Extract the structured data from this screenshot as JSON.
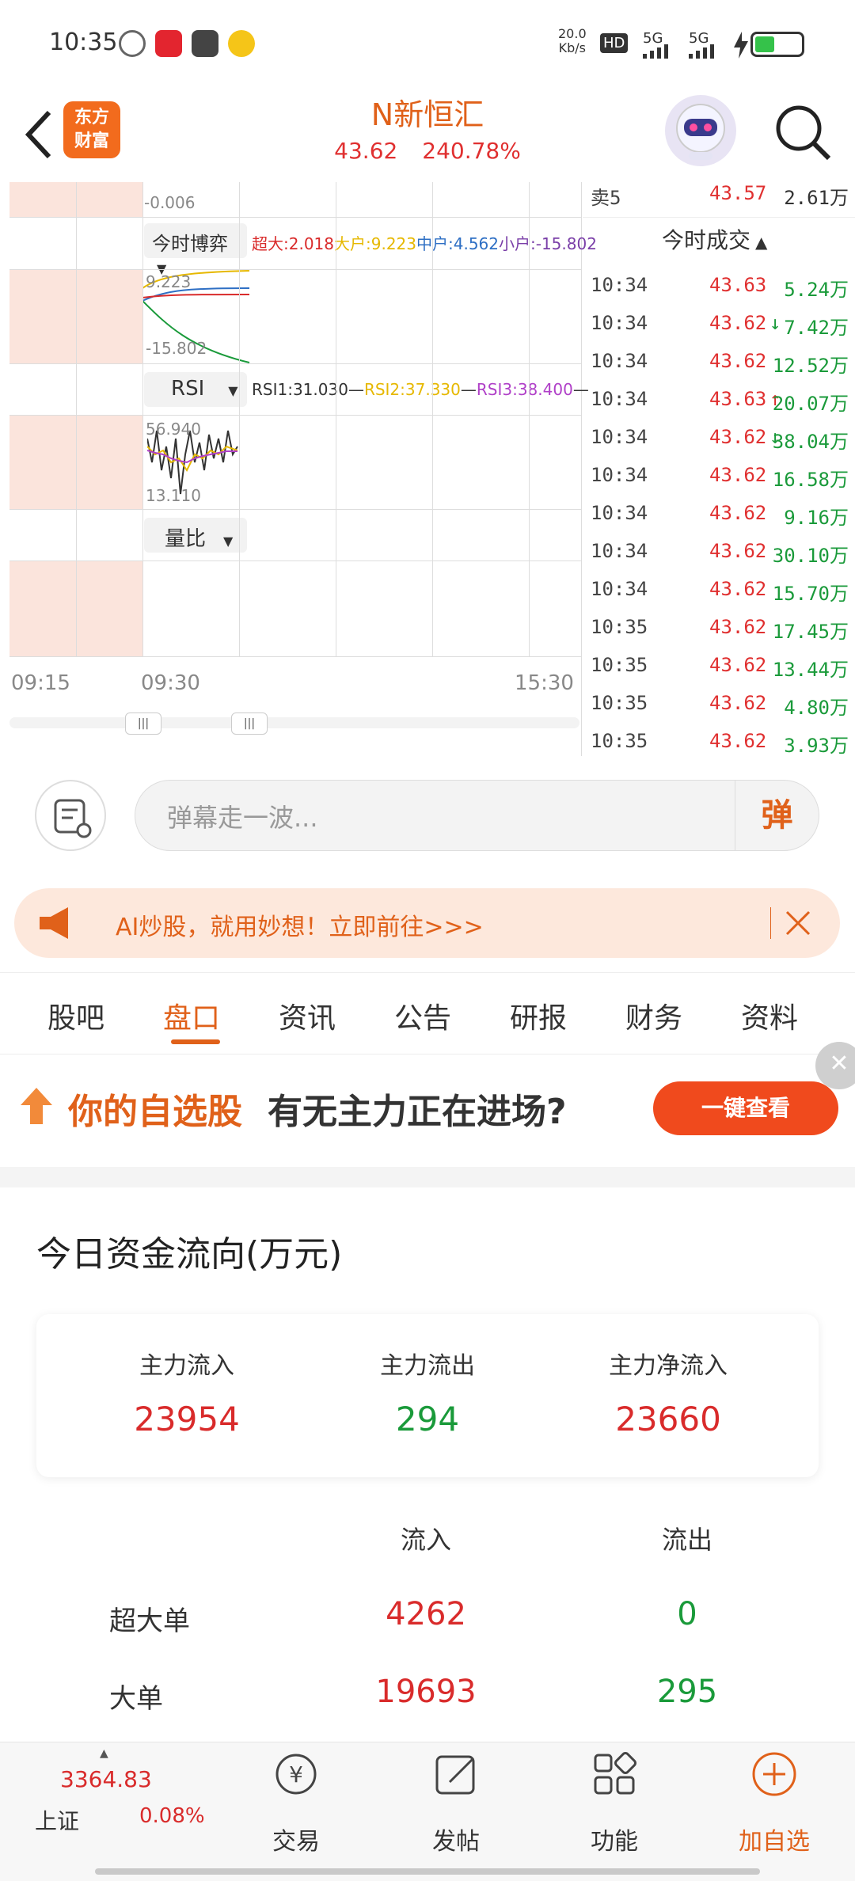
{
  "status_bar": {
    "time": "10:35",
    "net_speed": "20.0",
    "net_unit": "Kb/s",
    "hd": "HD",
    "signal1": "5G",
    "signal2": "5G"
  },
  "header": {
    "logo_line1": "东方",
    "logo_line2": "财富",
    "stock_name": "N新恒汇",
    "price": "43.62",
    "change_pct": "240.78%"
  },
  "chart": {
    "top_value": "-0.006",
    "indicator1": {
      "label": "今时博弈",
      "super_large": "超大:2.018",
      "large": "大户:9.223",
      "medium": "中户:4.562",
      "small": "小户:-15.802",
      "axis_top": "9.223",
      "axis_bottom": "-15.802"
    },
    "indicator2": {
      "label": "RSI",
      "rsi1": "RSI1:31.030",
      "rsi2": "RSI2:37.330",
      "rsi3": "RSI3:38.400",
      "axis_top": "56.940",
      "axis_bottom": "13.110"
    },
    "indicator3": {
      "label": "量比"
    },
    "time_axis": [
      "09:15",
      "09:30",
      "15:30"
    ]
  },
  "trades": {
    "sell5_label": "卖5",
    "sell5_price": "43.57",
    "sell5_vol": "2.61万",
    "header": "今时成交",
    "rows": [
      {
        "time": "10:34",
        "price": "43.63",
        "vol": "5.24万",
        "dir": ""
      },
      {
        "time": "10:34",
        "price": "43.62",
        "vol": "7.42万",
        "dir": "down"
      },
      {
        "time": "10:34",
        "price": "43.62",
        "vol": "12.52万",
        "dir": ""
      },
      {
        "time": "10:34",
        "price": "43.63",
        "vol": "20.07万",
        "dir": "up"
      },
      {
        "time": "10:34",
        "price": "43.62",
        "vol": "38.04万",
        "dir": "down"
      },
      {
        "time": "10:34",
        "price": "43.62",
        "vol": "16.58万",
        "dir": ""
      },
      {
        "time": "10:34",
        "price": "43.62",
        "vol": "9.16万",
        "dir": ""
      },
      {
        "time": "10:34",
        "price": "43.62",
        "vol": "30.10万",
        "dir": ""
      },
      {
        "time": "10:34",
        "price": "43.62",
        "vol": "15.70万",
        "dir": ""
      },
      {
        "time": "10:35",
        "price": "43.62",
        "vol": "17.45万",
        "dir": ""
      },
      {
        "time": "10:35",
        "price": "43.62",
        "vol": "13.44万",
        "dir": ""
      },
      {
        "time": "10:35",
        "price": "43.62",
        "vol": "4.80万",
        "dir": ""
      },
      {
        "time": "10:35",
        "price": "43.62",
        "vol": "3.93万",
        "dir": ""
      }
    ]
  },
  "comment": {
    "placeholder": "弹幕走一波...",
    "danmu_label": "弹"
  },
  "ai_banner": {
    "text": "AI炒股，就用妙想！立即前往>>>"
  },
  "tabs": [
    "股吧",
    "盘口",
    "资讯",
    "公告",
    "研报",
    "财务",
    "资料"
  ],
  "active_tab": "盘口",
  "ad": {
    "text_highlight": "你的自选股",
    "text_rest": "有无主力正在进场?",
    "button": "一键查看"
  },
  "capital_flow": {
    "title": "今日资金流向(万元)",
    "main_in_label": "主力流入",
    "main_in": "23954",
    "main_out_label": "主力流出",
    "main_out": "294",
    "main_net_label": "主力净流入",
    "main_net": "23660",
    "col_in": "流入",
    "col_out": "流出",
    "rows": [
      {
        "label": "超大单",
        "in": "4262",
        "out": "0"
      },
      {
        "label": "大单",
        "in": "19693",
        "out": "295"
      }
    ]
  },
  "bottom_nav": {
    "index_value": "3364.83",
    "index_name": "上证",
    "index_change": "0.08%",
    "trade": "交易",
    "post": "发帖",
    "function": "功能",
    "add_watch": "加自选"
  },
  "colors": {
    "accent": "#e0611a",
    "up": "#d92b2b",
    "down": "#1a9a3a"
  }
}
